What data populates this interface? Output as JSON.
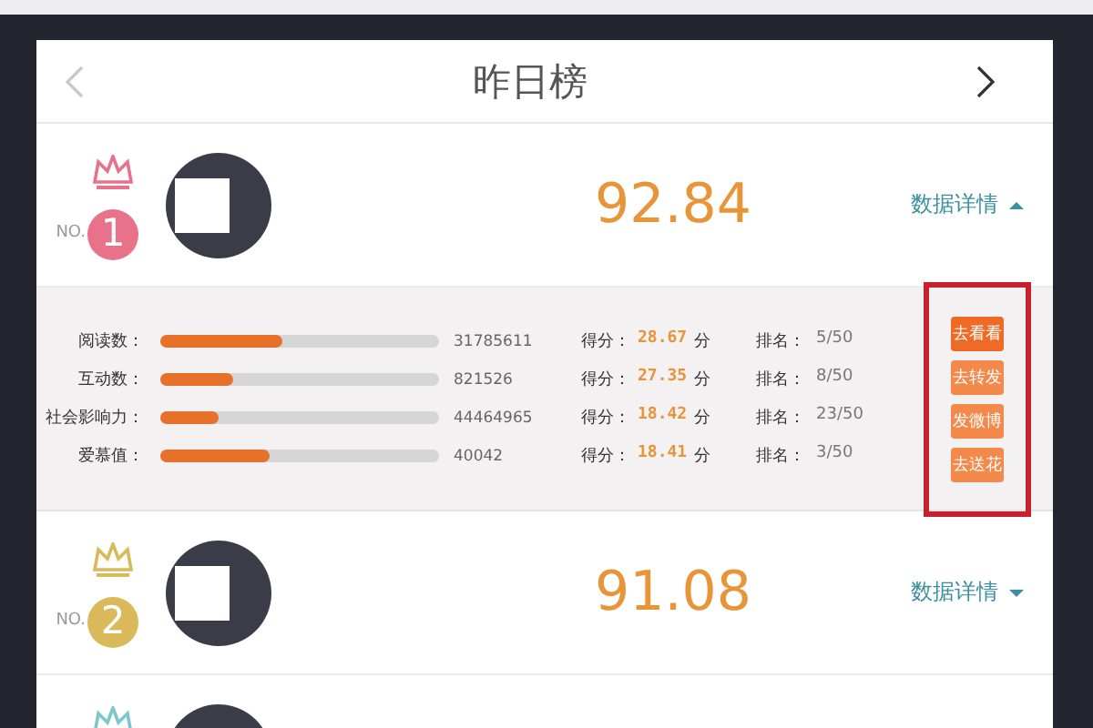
{
  "board": {
    "title": "昨日榜",
    "prev_disabled": true,
    "next_disabled": false
  },
  "entries": [
    {
      "no_label": "NO.",
      "rank": "1",
      "color": "#e8728a",
      "score": "92.84",
      "details_label": "数据详情",
      "expanded": true,
      "details": {
        "highlighted": true,
        "metrics": [
          {
            "label": "阅读数：",
            "level": 0.44,
            "value": "31785611",
            "score_label": "得分：",
            "score": "28.67",
            "score_unit": "分",
            "rank_label": "排名：",
            "rank": "5/50"
          },
          {
            "label": "互动数：",
            "level": 0.26,
            "value": "821526",
            "score_label": "得分：",
            "score": "27.35",
            "score_unit": "分",
            "rank_label": "排名：",
            "rank": "8/50"
          },
          {
            "label": "社会影响力：",
            "level": 0.21,
            "value": "44464965",
            "score_label": "得分：",
            "score": "18.42",
            "score_unit": "分",
            "rank_label": "排名：",
            "rank": "23/50"
          },
          {
            "label": "爱慕值：",
            "level": 0.39,
            "value": "40042",
            "score_label": "得分：",
            "score": "18.41",
            "score_unit": "分",
            "rank_label": "排名：",
            "rank": "3/50"
          }
        ],
        "actions": [
          {
            "label": "去看看",
            "selected": true
          },
          {
            "label": "去转发",
            "selected": false
          },
          {
            "label": "发微博",
            "selected": false
          },
          {
            "label": "去送花",
            "selected": false
          }
        ]
      }
    },
    {
      "no_label": "NO.",
      "rank": "2",
      "color": "#d9b95a",
      "score": "91.08",
      "details_label": "数据详情",
      "expanded": false
    },
    {
      "color": "#7cc6cc"
    }
  ]
}
